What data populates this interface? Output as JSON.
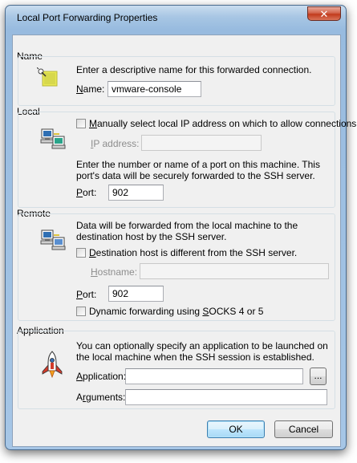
{
  "window": {
    "title": "Local Port Forwarding Properties",
    "close_glyph": "✕"
  },
  "name_group": {
    "label": "Name",
    "icon": "tag-icon",
    "description": "Enter a descriptive name for this forwarded connection.",
    "field_label_accel": "N",
    "field_label_rest": "ame:",
    "value": "vmware-console"
  },
  "local_group": {
    "label": "Local",
    "icon": "computer-icon",
    "checkbox_accel": "M",
    "checkbox_rest": "anually select local IP address on which to allow connections.",
    "checkbox_checked": false,
    "ip_label_accel": "I",
    "ip_label_rest": "P address:",
    "ip_value": "",
    "description": "Enter the number or name of a port on this machine.  This port's data will be securely forwarded to the SSH server.",
    "port_label_accel": "P",
    "port_label_rest": "ort:",
    "port_value": "902"
  },
  "remote_group": {
    "label": "Remote",
    "icon": "network-computer-icon",
    "description": "Data will be forwarded from the local machine to the destination host by the SSH server.",
    "dest_checkbox_accel": "D",
    "dest_checkbox_rest": "estination host is different from the SSH server.",
    "dest_checkbox_checked": false,
    "hostname_label_accel": "H",
    "hostname_label_rest": "ostname:",
    "hostname_value": "",
    "port_label_accel": "P",
    "port_label_rest": "ort:",
    "port_value": "902",
    "socks_checkbox_before": "Dynamic forwarding using ",
    "socks_checkbox_accel": "S",
    "socks_checkbox_after": "OCKS 4 or 5",
    "socks_checkbox_checked": false
  },
  "application_group": {
    "label": "Application",
    "icon": "rocket-icon",
    "description": "You can optionally specify an application to be launched on the local machine when the SSH session is established.",
    "application_label_accel": "A",
    "application_label_rest": "pplication:",
    "application_value": "",
    "browse_label": "...",
    "arguments_label_before": "A",
    "arguments_label_accel": "r",
    "arguments_label_after": "guments:",
    "arguments_value": ""
  },
  "buttons": {
    "ok": "OK",
    "cancel": "Cancel"
  },
  "colors": {
    "title_bar": "#a8c6e4",
    "client_background": "#f0f0f0",
    "close_button": "#c23a1c",
    "default_button_border": "#3c7fb1"
  }
}
